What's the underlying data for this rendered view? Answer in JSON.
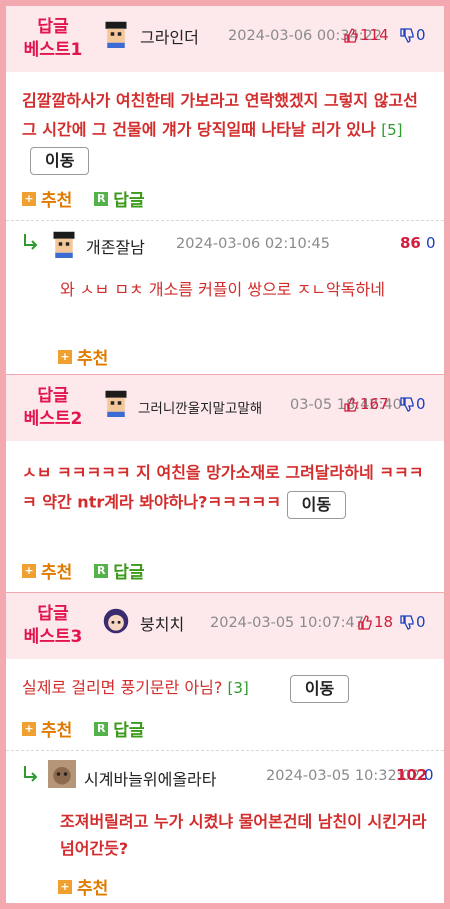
{
  "labels": {
    "recommend": "추천",
    "reply": "답글",
    "move": "이동"
  },
  "posts": [
    {
      "best_label": "답글\n베스트1",
      "nick": "그라인더",
      "date": "2024-03-06 00:34:22",
      "up": "114",
      "down": "0",
      "text": "김깔깔하사가 여친한테 가보라고 연락했겠지 그렇지 않고선 그 시간에 그 건물에 걔가 당직일때 나타날 리가 있나",
      "count": "[5]",
      "reply": {
        "nick": "개존잘남",
        "date": "2024-03-06 02:10:45",
        "up": "86",
        "down": "0",
        "text": "와 ㅅㅂ ㅁㅊ 개소름 커플이 쌍으로 ㅈㄴ악독하네"
      }
    },
    {
      "best_label": "답글\n베스트2",
      "nick": "그러니깐울지말고말해",
      "date": "03-05 18:42:40",
      "up": "167",
      "down": "0",
      "text": "ㅅㅂ ㅋㅋㅋㅋㅋ 지 여친을 망가소재로 그려달라하네 ㅋㅋㅋㅋ 약간 ntr계라 봐야하나?ㅋㅋㅋㅋㅋ",
      "count": ""
    },
    {
      "best_label": "답글\n베스트3",
      "nick": "붕치치",
      "date": "2024-03-05 10:07:47",
      "up": "18",
      "down": "0",
      "text": "실제로 걸리면 풍기문란 아님?",
      "count": "[3]",
      "reply": {
        "nick": "시계바늘위에올라타",
        "date": "2024-03-05 10:32:02",
        "up": "102",
        "down": "0",
        "text": "조져버릴려고 누가 시켰냐 물어본건데 남친이 시킨거라 넘어간듯?"
      }
    }
  ]
}
